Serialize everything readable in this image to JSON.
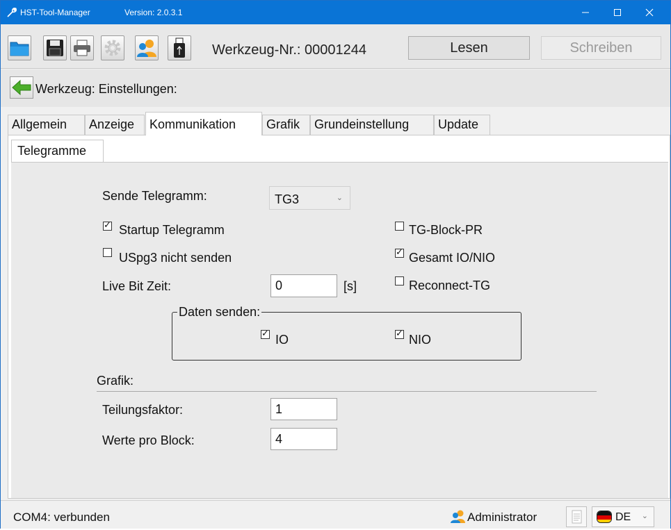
{
  "titlebar": {
    "title": "HST-Tool-Manager",
    "version": "Version: 2.0.3.1"
  },
  "toolbar": {
    "tool_number": "Werkzeug-Nr.: 00001244",
    "read_label": "Lesen",
    "write_label": "Schreiben",
    "icons": [
      "folder-icon",
      "save-icon",
      "print-icon",
      "settings-gear-icon",
      "users-icon",
      "usb-stick-icon"
    ]
  },
  "breadcrumb": {
    "text": "Werkzeug: Einstellungen:"
  },
  "tabs": [
    {
      "label": "Allgemein",
      "active": false
    },
    {
      "label": "Anzeige",
      "active": false
    },
    {
      "label": "Kommunikation",
      "active": true
    },
    {
      "label": "Grafik",
      "active": false
    },
    {
      "label": "Grundeinstellung",
      "active": false
    },
    {
      "label": "Update",
      "active": false
    }
  ],
  "subtab": {
    "label": "Telegramme"
  },
  "form": {
    "send_telegram_label": "Sende Telegramm:",
    "send_telegram_value": "TG3",
    "startup_telegram": {
      "label": "Startup Telegramm",
      "checked": true
    },
    "uspg3_not_send": {
      "label": "USpg3 nicht senden",
      "checked": false
    },
    "tg_block_pr": {
      "label": "TG-Block-PR",
      "checked": false
    },
    "gesamt_io_nio": {
      "label": "Gesamt IO/NIO",
      "checked": true
    },
    "reconnect_tg": {
      "label": "Reconnect-TG",
      "checked": false
    },
    "live_bit_label": "Live Bit Zeit:",
    "live_bit_value": "0",
    "live_bit_unit": "[s]",
    "data_send_title": "Daten senden:",
    "io": {
      "label": "IO",
      "checked": true
    },
    "nio": {
      "label": "NIO",
      "checked": true
    },
    "grafik_title": "Grafik:",
    "teilungsfaktor_label": "Teilungsfaktor:",
    "teilungsfaktor_value": "1",
    "werte_pro_block_label": "Werte pro Block:",
    "werte_pro_block_value": "4"
  },
  "statusbar": {
    "connection": "COM4: verbunden",
    "user": "Administrator",
    "language": "DE"
  },
  "colors": {
    "titlebar": "#0a74d6",
    "back_arrow": "#4caf2a"
  }
}
